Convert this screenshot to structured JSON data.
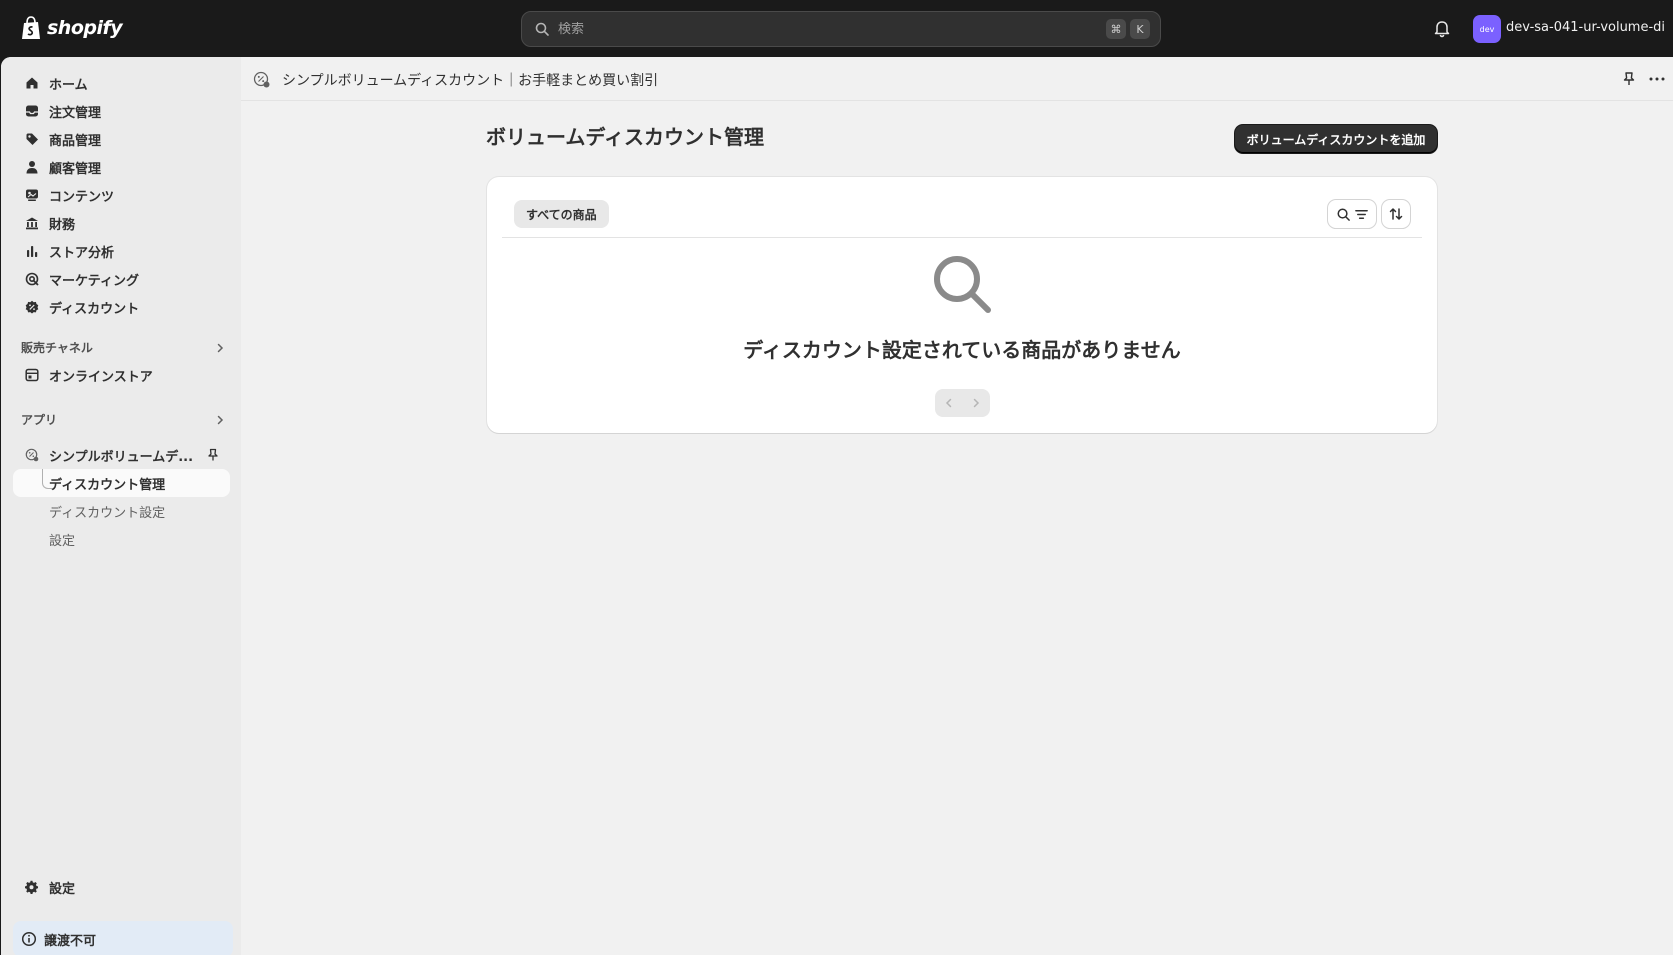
{
  "topbar": {
    "brand": "shopify",
    "search_placeholder": "検索",
    "shortcut_keys": [
      "⌘",
      "K"
    ],
    "store_avatar": "dev",
    "store_name": "dev-sa-041-ur-volume-di..."
  },
  "sidebar": {
    "items": [
      {
        "label": "ホーム",
        "icon": "home-icon"
      },
      {
        "label": "注文管理",
        "icon": "inbox-icon"
      },
      {
        "label": "商品管理",
        "icon": "tag-icon"
      },
      {
        "label": "顧客管理",
        "icon": "person-icon"
      },
      {
        "label": "コンテンツ",
        "icon": "content-icon"
      },
      {
        "label": "財務",
        "icon": "bank-icon"
      },
      {
        "label": "ストア分析",
        "icon": "bar-chart-icon"
      },
      {
        "label": "マーケティング",
        "icon": "target-icon"
      },
      {
        "label": "ディスカウント",
        "icon": "discount-icon"
      }
    ],
    "sales_channels_label": "販売チャネル",
    "online_store_label": "オンラインストア",
    "apps_label": "アプリ",
    "app_name": "シンプルボリュームデ...",
    "app_subitems": [
      "ディスカウント管理",
      "ディスカウント設定",
      "設定"
    ],
    "settings_label": "設定",
    "notice_label": "譲渡不可"
  },
  "app_header": {
    "title": "シンプルボリュームディスカウント｜お手軽まとめ買い割引"
  },
  "page": {
    "title": "ボリュームディスカウント管理",
    "add_button": "ボリュームディスカウントを追加",
    "tab_all": "すべての商品",
    "empty_message": "ディスカウント設定されている商品がありません"
  },
  "colors": {
    "topbar_bg": "#1a1a1a",
    "primary_button": "#303030",
    "avatar": "#7b61ff",
    "notice_bg": "#e2ebf6"
  }
}
